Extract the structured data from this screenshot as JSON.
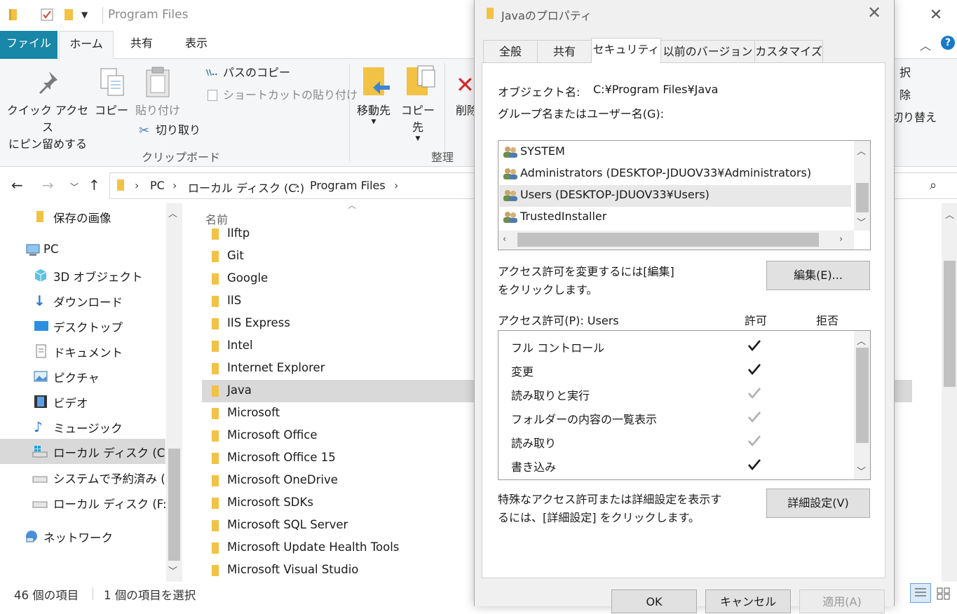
{
  "explorer": {
    "window_title": "Program Files",
    "ribbon_tabs": [
      "ファイル",
      "ホーム",
      "共有",
      "表示"
    ],
    "ribbon": {
      "pin_label_1": "クイック アクセス",
      "pin_label_2": "にピン留めする",
      "copy_label": "コピー",
      "paste_label": "貼り付け",
      "copy_path_label": "パスのコピー",
      "paste_shortcut_label": "ショートカットの貼り付け",
      "cut_label": "切り取り",
      "clipboard_group": "クリップボード",
      "move_to_label": "移動先",
      "copy_to_label": "コピー先",
      "delete_label": "削除",
      "organize_group": "整理",
      "right_label_1": "択",
      "right_label_2": "除",
      "right_label_3": "切り替え"
    },
    "breadcrumb": [
      "PC",
      "ローカル ディスク (C:)",
      "Program Files"
    ],
    "nav_pane": [
      {
        "label": "保存の画像",
        "icon": "folder-icon"
      },
      {
        "label": "PC",
        "icon": "pc-icon"
      },
      {
        "label": "3D オブジェクト",
        "icon": "3d-objects-icon"
      },
      {
        "label": "ダウンロード",
        "icon": "download-icon"
      },
      {
        "label": "デスクトップ",
        "icon": "desktop-icon"
      },
      {
        "label": "ドキュメント",
        "icon": "document-icon"
      },
      {
        "label": "ピクチャ",
        "icon": "pictures-icon"
      },
      {
        "label": "ビデオ",
        "icon": "video-icon"
      },
      {
        "label": "ミュージック",
        "icon": "music-icon"
      },
      {
        "label": "ローカル ディスク (C:)",
        "icon": "windows-drive-icon",
        "selected": true
      },
      {
        "label": "システムで予約済み (D",
        "icon": "drive-icon"
      },
      {
        "label": "ローカル ディスク (F:)",
        "icon": "drive-icon"
      },
      {
        "label": "ネットワーク",
        "icon": "network-icon"
      }
    ],
    "column_header": "名前",
    "files": [
      "IIftp",
      "Git",
      "Google",
      "IIS",
      "IIS Express",
      "Intel",
      "Internet Explorer",
      "Java",
      "Microsoft",
      "Microsoft Office",
      "Microsoft Office 15",
      "Microsoft OneDrive",
      "Microsoft SDKs",
      "Microsoft SQL Server",
      "Microsoft Update Health Tools",
      "Microsoft Visual Studio"
    ],
    "selected_file": "Java",
    "status": {
      "item_count": "46 個の項目",
      "selected_count": "1 個の項目を選択"
    }
  },
  "dialog": {
    "title": "Javaのプロパティ",
    "tabs": [
      "全般",
      "共有",
      "セキュリティ",
      "以前のバージョン",
      "カスタマイズ"
    ],
    "active_tab": "セキュリティ",
    "object_name_label": "オブジェクト名:",
    "object_name_value": "C:¥Program Files¥Java",
    "group_label": "グループ名またはユーザー名(G):",
    "groups": [
      "SYSTEM",
      "Administrators (DESKTOP-JDUOV33¥Administrators)",
      "Users (DESKTOP-JDUOV33¥Users)",
      "TrustedInstaller"
    ],
    "selected_group_index": 2,
    "change_hint_1": "アクセス許可を変更するには[編集]",
    "change_hint_2": "をクリックします。",
    "edit_button": "編集(E)...",
    "perm_label": "アクセス許可(P): Users",
    "allow_header": "許可",
    "deny_header": "拒否",
    "permissions": [
      {
        "name": "フル コントロール",
        "allow": "explicit"
      },
      {
        "name": "変更",
        "allow": "explicit"
      },
      {
        "name": "読み取りと実行",
        "allow": "inherited"
      },
      {
        "name": "フォルダーの内容の一覧表示",
        "allow": "inherited"
      },
      {
        "name": "読み取り",
        "allow": "inherited"
      },
      {
        "name": "書き込み",
        "allow": "explicit"
      }
    ],
    "advanced_hint_1": "特殊なアクセス許可または詳細設定を表示す",
    "advanced_hint_2": "るには、[詳細設定] をクリックします。",
    "advanced_button": "詳細設定(V)",
    "ok_button": "OK",
    "cancel_button": "キャンセル",
    "apply_button": "適用(A)"
  },
  "colors": {
    "file_tab_bg": "#1887a8",
    "folder_yellow": "#f2c244",
    "selection_gray": "#d9d9d9",
    "check_dark": "#1a1a1a",
    "check_inherited": "#b0b0b0"
  }
}
